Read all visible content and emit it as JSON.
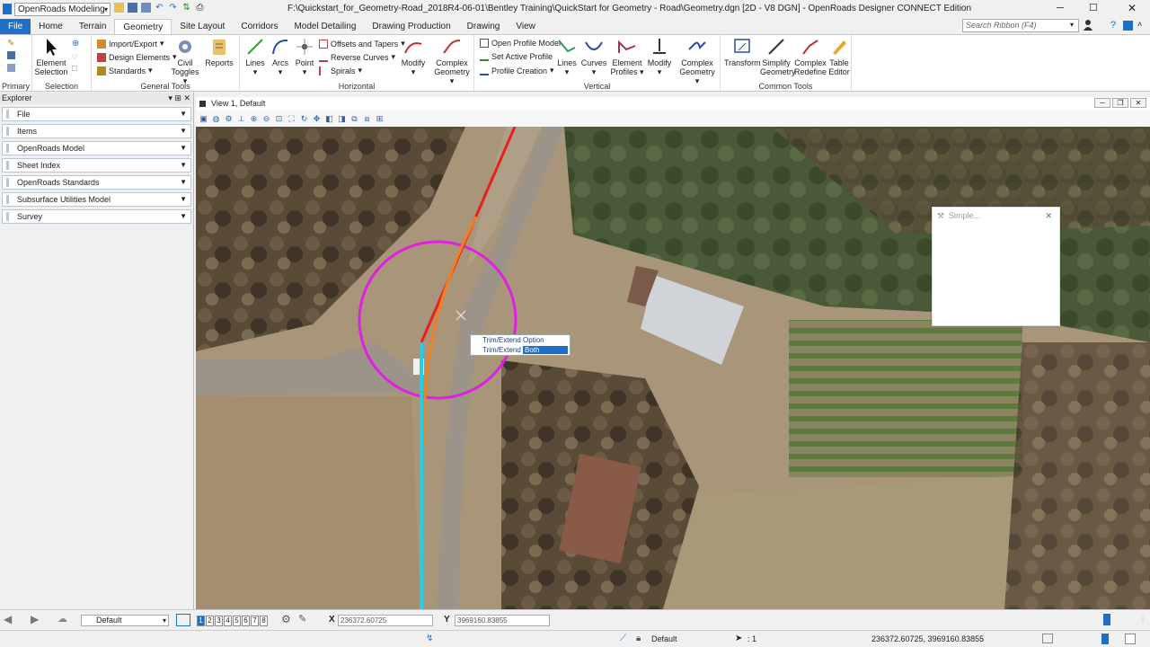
{
  "titlebar": {
    "workspace": "OpenRoads Modeling",
    "title": "F:\\Quickstart_for_Geometry-Road_2018R4-06-01\\Bentley Training\\QuickStart for Geometry - Road\\Geometry.dgn [2D - V8 DGN] - OpenRoads Designer CONNECT Edition",
    "search_placeholder": "Search Ribbon (F4)"
  },
  "tabs": [
    "File",
    "Home",
    "Terrain",
    "Geometry",
    "Site Layout",
    "Corridors",
    "Model Detailing",
    "Drawing Production",
    "Drawing",
    "View"
  ],
  "ribbon": {
    "primary": "Primary",
    "selection": {
      "label": "Selection",
      "element_selection": "Element Selection"
    },
    "general_tools": {
      "label": "General Tools",
      "import_export": "Import/Export",
      "design_elements": "Design Elements",
      "standards": "Standards",
      "civil_toggles": "Civil Toggles",
      "reports": "Reports"
    },
    "horizontal": {
      "label": "Horizontal",
      "lines": "Lines",
      "arcs": "Arcs",
      "point": "Point",
      "offsets_tapers": "Offsets and Tapers",
      "reverse_curves": "Reverse Curves",
      "spirals": "Spirals",
      "modify": "Modify",
      "complex_geometry": "Complex Geometry"
    },
    "vertical": {
      "label": "Vertical",
      "open_profile_model": "Open Profile Model",
      "set_active_profile": "Set Active Profile",
      "profile_creation": "Profile Creation",
      "lines": "Lines",
      "curves": "Curves",
      "element_profiles": "Element Profiles",
      "modify": "Modify",
      "complex_geometry": "Complex Geometry"
    },
    "common_tools": {
      "label": "Common Tools",
      "transform": "Transform",
      "simplify_geometry": "Simplify Geometry",
      "complex_redefine": "Complex Redefine",
      "table_editor": "Table Editor"
    }
  },
  "explorer": {
    "title": "Explorer",
    "items": [
      "File",
      "Items",
      "OpenRoads Model",
      "Sheet Index",
      "OpenRoads Standards",
      "Subsurface Utilities Model",
      "Survey"
    ]
  },
  "view": {
    "title": "View 1, Default"
  },
  "popup": {
    "header": "Trim/Extend Option",
    "label": "Trim/Extend",
    "value": "Both"
  },
  "simple_dialog": {
    "title": "Simple..."
  },
  "status": {
    "level": "Default",
    "view_numbers": [
      "1",
      "2",
      "3",
      "4",
      "5",
      "6",
      "7",
      "8"
    ],
    "x_label": "X",
    "x_value": "236372.60725",
    "y_label": "Y",
    "y_value": "3969160.83855",
    "active_level": "Default",
    "scale": ": 1",
    "coords": "236372.60725, 3969160.83855"
  },
  "colors": {
    "accent": "#1e6fc6",
    "circle": "#e020e0",
    "red_line": "#e8201c",
    "orange_line": "#f08020",
    "cyan_line": "#20d0e8"
  }
}
